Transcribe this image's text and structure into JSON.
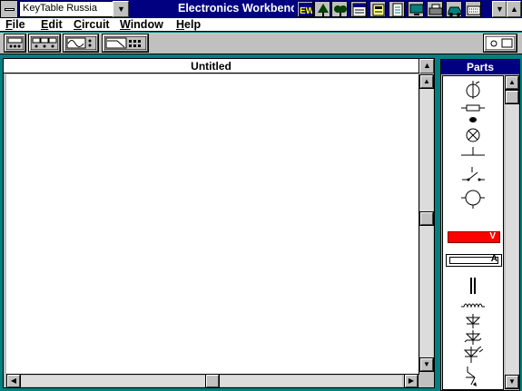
{
  "titlebar": {
    "keytable_value": "KeyTable Russia",
    "app_title": "Electronics Workbenc",
    "tray_icons": [
      "ew-logo-icon",
      "tree-icon",
      "tree-icon",
      "calendar-icon",
      "phone-icon",
      "notepad-icon",
      "monitor-icon",
      "printer-icon",
      "car-icon",
      "keyboard-icon"
    ]
  },
  "menu": {
    "file": "File",
    "edit": "Edit",
    "circuit": "Circuit",
    "window": "Window",
    "help": "Help"
  },
  "toolbar": {
    "items": [
      "function-generator-icon",
      "multimeter-icon",
      "oscilloscope-icon",
      "bode-plotter-icon"
    ],
    "right_item": "word-generator-icon"
  },
  "circuit_window": {
    "title": "Untitled"
  },
  "parts_bin": {
    "title": "Parts",
    "voltmeter_label": "V",
    "ammeter_label": "A",
    "items": [
      "ground-icon",
      "resistor-icon",
      "connector-dot-icon",
      "lamp-icon",
      "battery-icon",
      "switch-icon",
      "ac-source-icon",
      "voltmeter-icon",
      "ammeter-icon",
      "capacitor-icon",
      "inductor-icon",
      "diode-icon",
      "zener-diode-icon",
      "led-icon",
      "transistor-icon"
    ]
  }
}
